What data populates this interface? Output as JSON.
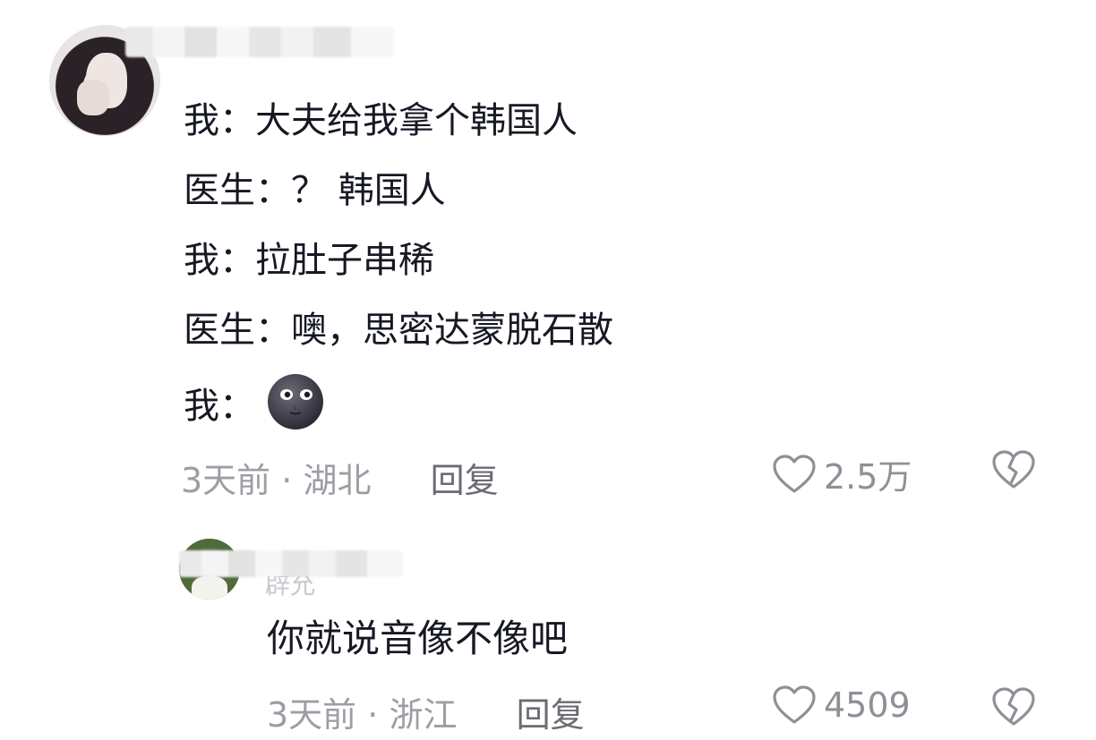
{
  "comments": [
    {
      "lines": [
        {
          "speaker": "我：",
          "text": "大夫给我拿个韩国人"
        },
        {
          "speaker": "医生：",
          "text": "？ 韩国人"
        },
        {
          "speaker": "我：",
          "text": "拉肚子串稀"
        },
        {
          "speaker": "医生：",
          "text": "噢，思密达蒙脱石散"
        },
        {
          "speaker": "我：",
          "text": ""
        }
      ],
      "emoji": "new-moon-face-icon",
      "time": "3天前",
      "separator": "·",
      "location": "湖北",
      "reply_label": "回复",
      "likes": "2.5万"
    },
    {
      "name_fragment": "辟允",
      "text": "你就说音像不像吧",
      "time": "3天前",
      "separator": "·",
      "location": "浙江",
      "reply_label": "回复",
      "likes": "4509"
    }
  ],
  "colors": {
    "text": "#161823",
    "meta": "#9d9ea5",
    "icon": "#8f9097"
  }
}
